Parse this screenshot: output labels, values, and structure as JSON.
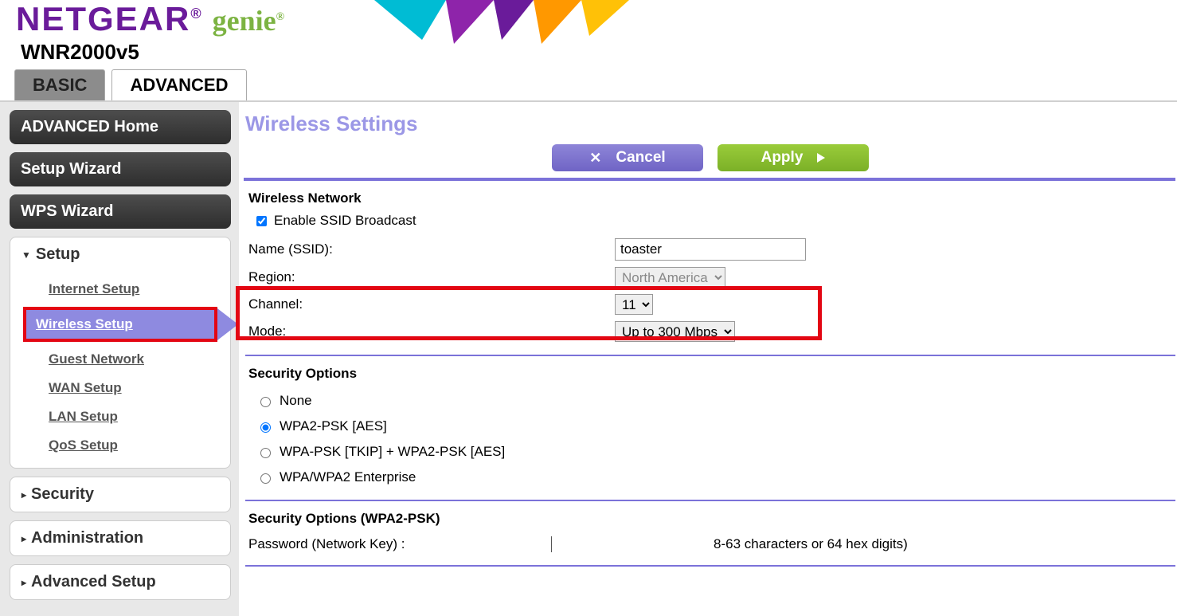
{
  "header": {
    "brand": "NETGEAR",
    "product": "genie",
    "model": "WNR2000v5"
  },
  "tabs": {
    "basic": "BASIC",
    "advanced": "ADVANCED"
  },
  "sidebar": {
    "advanced_home": "ADVANCED Home",
    "setup_wizard": "Setup Wizard",
    "wps_wizard": "WPS Wizard",
    "groups": {
      "setup": {
        "label": "Setup",
        "items": {
          "internet": "Internet Setup",
          "wireless": "Wireless Setup",
          "guest": "Guest Network",
          "wan": "WAN Setup",
          "lan": "LAN Setup",
          "qos": "QoS Setup"
        }
      },
      "security": {
        "label": "Security"
      },
      "administration": {
        "label": "Administration"
      },
      "advanced_setup": {
        "label": "Advanced Setup"
      }
    }
  },
  "page": {
    "title": "Wireless Settings",
    "buttons": {
      "cancel": "Cancel",
      "apply": "Apply"
    },
    "wireless_network": {
      "heading": "Wireless Network",
      "enable_ssid_label": "Enable SSID Broadcast",
      "enable_ssid_checked": true,
      "name_label": "Name (SSID):",
      "name_value": "toaster",
      "region_label": "Region:",
      "region_value": "North America",
      "channel_label": "Channel:",
      "channel_value": "11",
      "mode_label": "Mode:",
      "mode_value": "Up to 300 Mbps"
    },
    "security_options": {
      "heading": "Security Options",
      "none": "None",
      "wpa2psk": "WPA2-PSK [AES]",
      "mixed": "WPA-PSK [TKIP] + WPA2-PSK [AES]",
      "enterprise": "WPA/WPA2 Enterprise",
      "selected": "wpa2psk"
    },
    "security_psk": {
      "heading": "Security Options (WPA2-PSK)",
      "password_label": "Password (Network Key) :",
      "hint": "8-63 characters or 64 hex digits)"
    }
  }
}
